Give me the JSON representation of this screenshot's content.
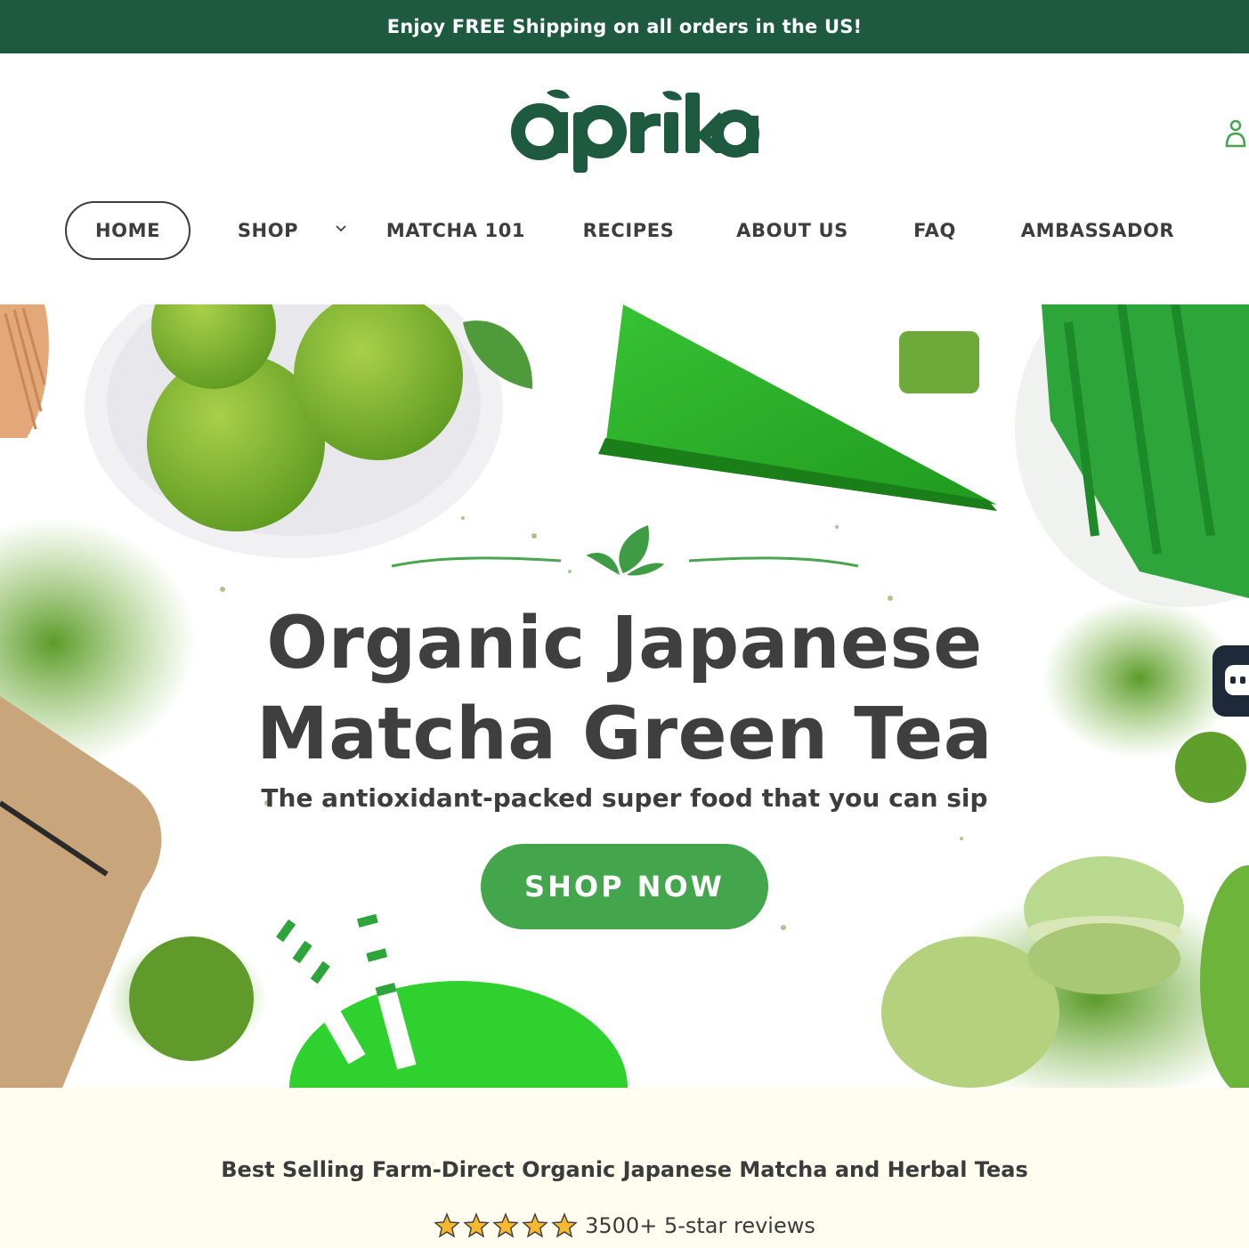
{
  "announcement": {
    "text": "Enjoy FREE Shipping on all orders in the US!"
  },
  "header": {
    "logo_text": "aprika",
    "nav": [
      {
        "label": "HOME",
        "active": true
      },
      {
        "label": "SHOP",
        "has_dropdown": true
      },
      {
        "label": "MATCHA 101"
      },
      {
        "label": "RECIPES"
      },
      {
        "label": "ABOUT US"
      },
      {
        "label": "FAQ"
      },
      {
        "label": "AMBASSADOR"
      }
    ],
    "icons": {
      "account": "account-icon",
      "dropdown": "chevron-down-icon"
    }
  },
  "hero": {
    "title_line1": "Organic Japanese",
    "title_line2": "Matcha Green Tea",
    "subtitle": "The antioxidant-packed super food that you can sip",
    "cta_label": "SHOP NOW"
  },
  "bestseller": {
    "title": "Best Selling Farm-Direct Organic Japanese Matcha and Herbal Teas",
    "rating_stars": 5,
    "reviews_text": "3500+ 5-star reviews"
  },
  "colors": {
    "brand_dark": "#1d5a40",
    "brand_green": "#44a64c",
    "text_dark": "#3d3d3d",
    "cream": "#fefdef",
    "star": "#f5b82e",
    "chat_bg": "#1e2a3a"
  }
}
